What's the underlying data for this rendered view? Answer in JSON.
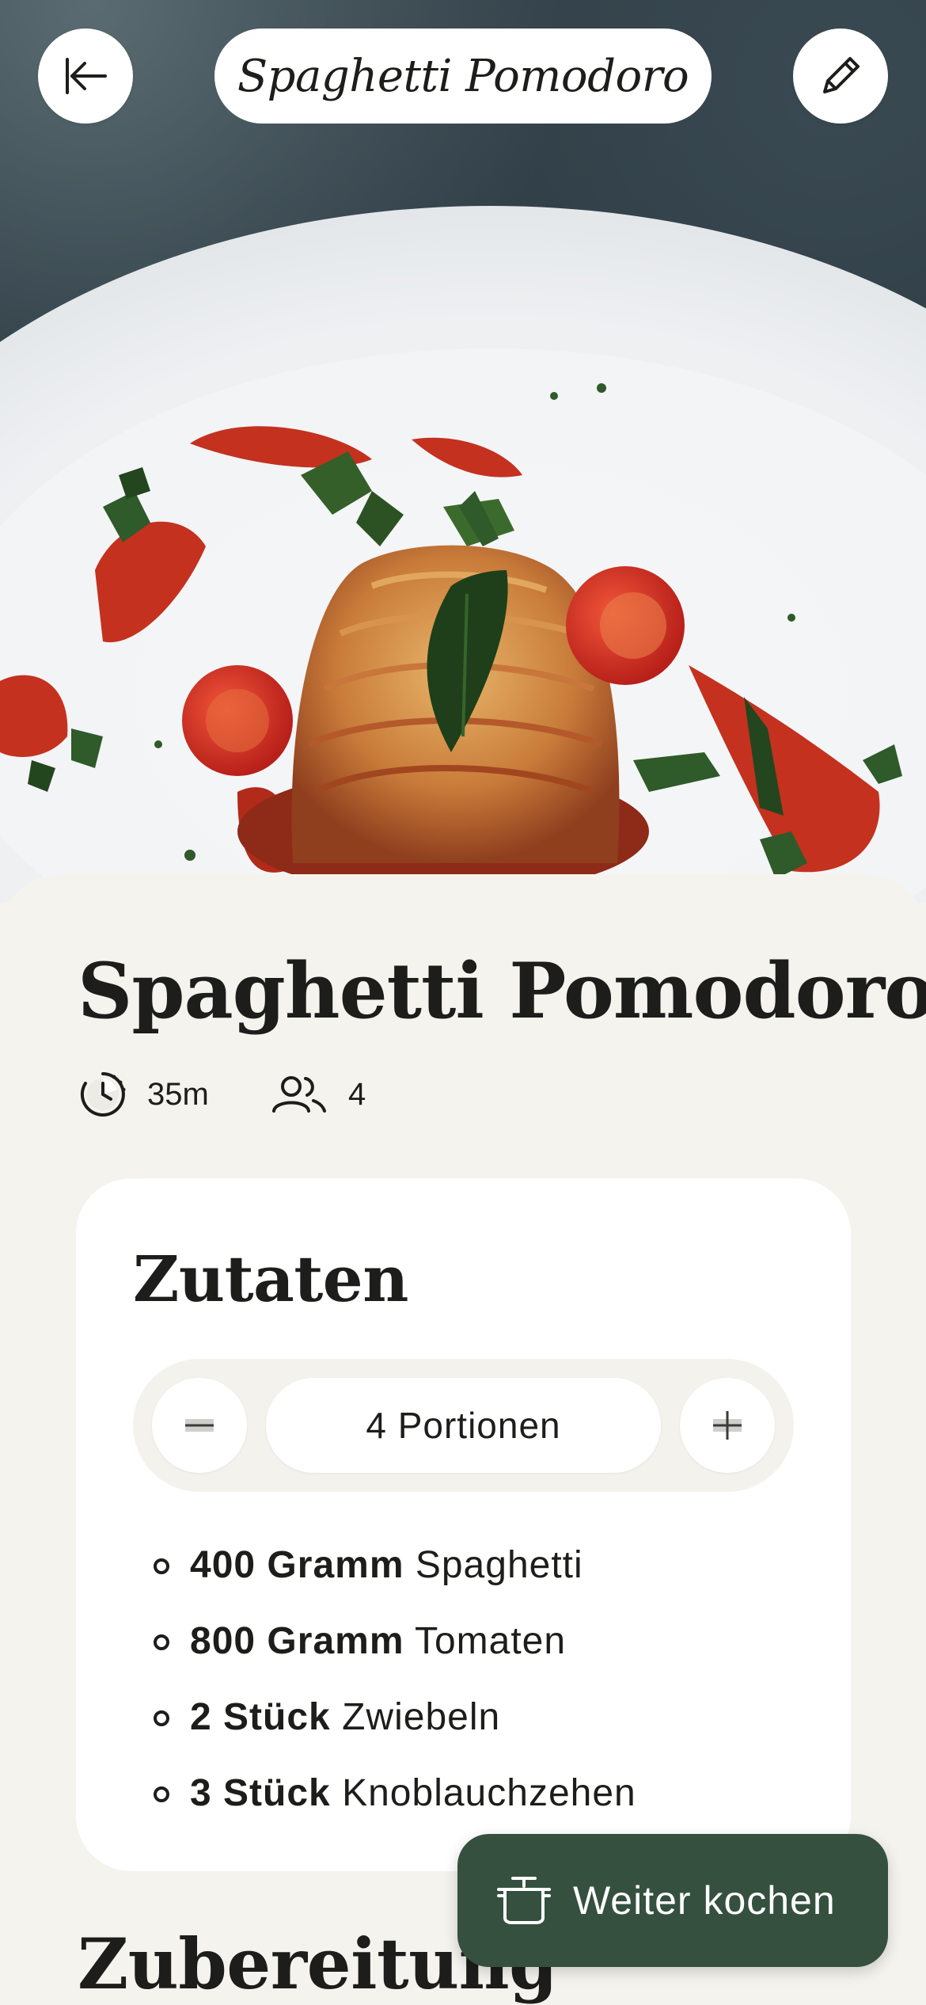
{
  "header": {
    "title": "Spaghetti Pomodoro",
    "back_icon": "arrow-left-icon",
    "edit_icon": "pencil-icon"
  },
  "hero": {
    "image": "spaghetti-plate-photo"
  },
  "recipe": {
    "title": "Spaghetti Pomodoro",
    "time": "35m",
    "time_icon": "clock-icon",
    "servings": "4",
    "servings_icon": "people-icon"
  },
  "ingredients": {
    "title": "Zutaten",
    "portions_label": "4 Portionen",
    "minus_icon": "minus-icon",
    "plus_icon": "plus-icon",
    "items": [
      {
        "amount": "400 Gramm",
        "name": "Spaghetti"
      },
      {
        "amount": "800 Gramm",
        "name": "Tomaten"
      },
      {
        "amount": "2 Stück",
        "name": "Zwiebeln"
      },
      {
        "amount": "3 Stück",
        "name": "Knoblauchzehen"
      }
    ]
  },
  "preparation": {
    "title": "Zubereitung"
  },
  "cook_button": {
    "label": "Weiter kochen",
    "icon": "cooking-pot-icon"
  },
  "colors": {
    "background": "#f5f3ee",
    "card": "#ffffff",
    "accent": "#35503f",
    "text": "#1d1d1b"
  }
}
